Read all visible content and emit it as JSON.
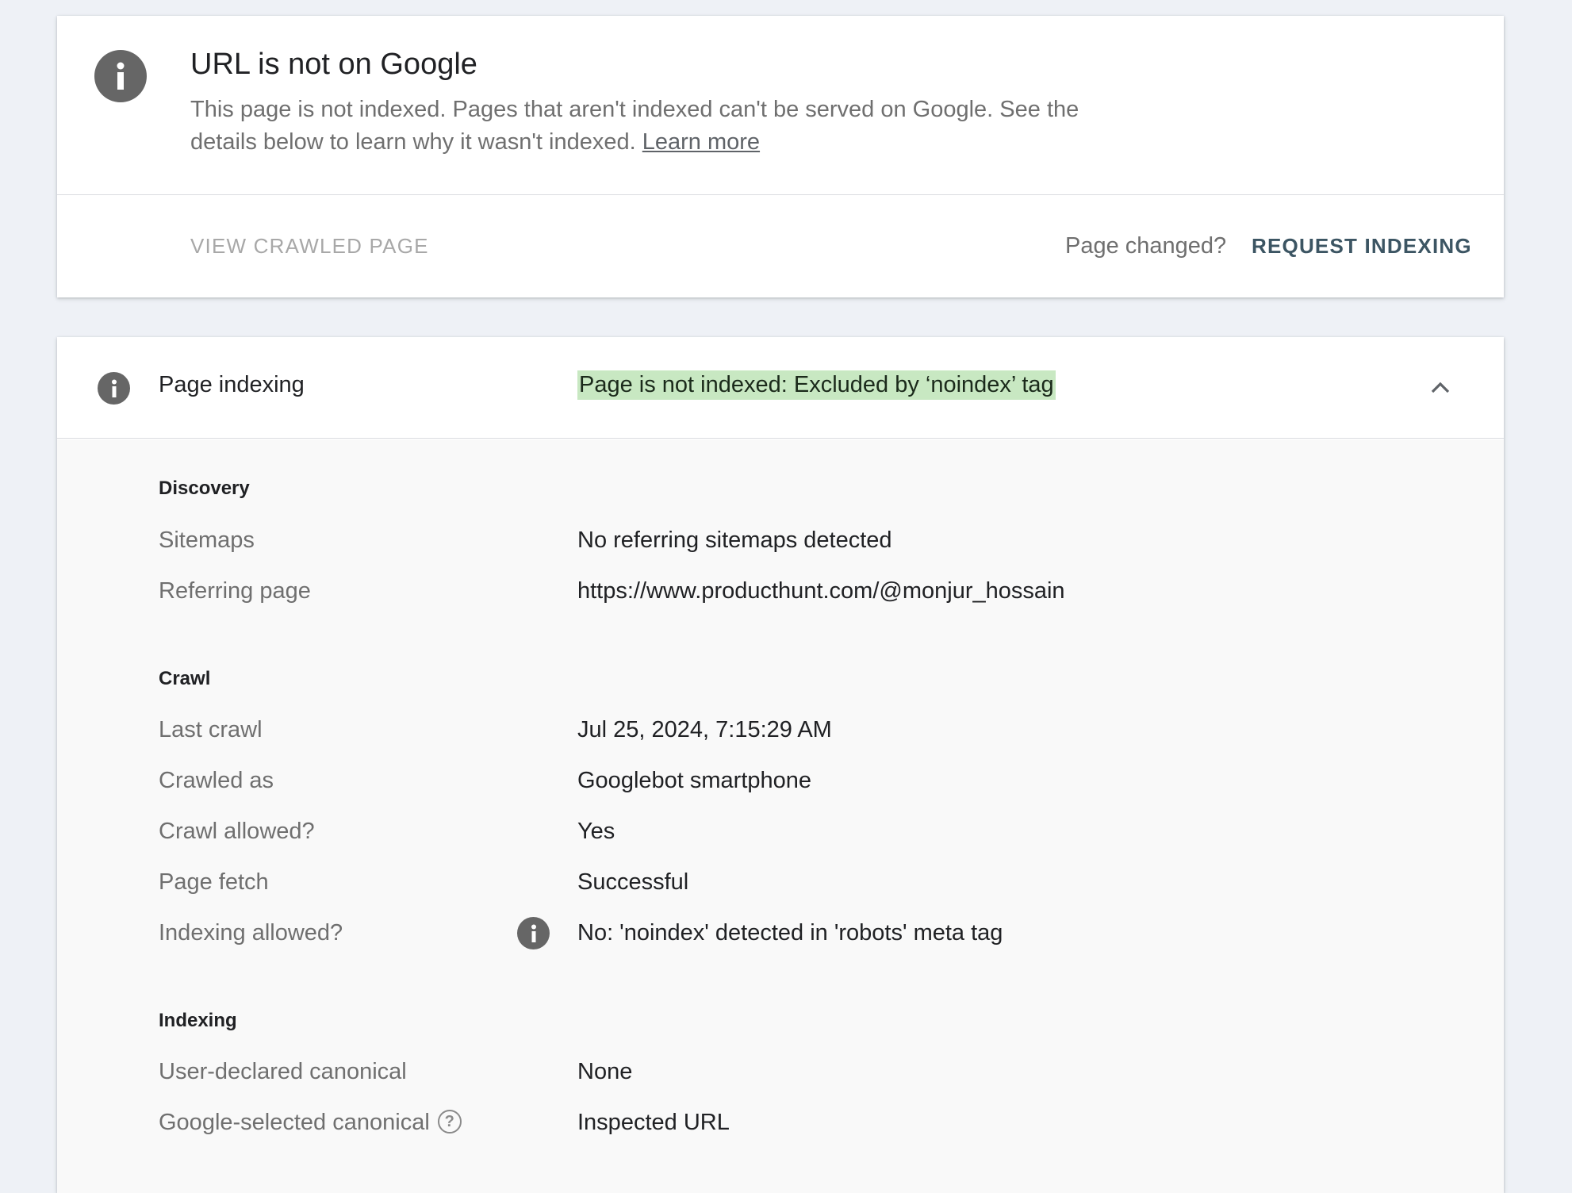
{
  "status_card": {
    "icon": "info-icon",
    "title": "URL is not on Google",
    "description": "This page is not indexed. Pages that aren't indexed can't be served on Google. See the details below to learn why it wasn't indexed.",
    "learn_more": "Learn more",
    "view_crawled_page": "VIEW CRAWLED PAGE",
    "page_changed": "Page changed?",
    "request_indexing": "REQUEST INDEXING"
  },
  "page_indexing": {
    "icon": "info-icon",
    "label": "Page indexing",
    "status": "Page is not indexed: Excluded by ‘noindex’ tag",
    "highlight_color": "#c8e8c2",
    "expanded": true,
    "sections": {
      "discovery": {
        "heading": "Discovery",
        "sitemaps_label": "Sitemaps",
        "sitemaps_value": "No referring sitemaps detected",
        "referring_label": "Referring page",
        "referring_value": "https://www.producthunt.com/@monjur_hossain"
      },
      "crawl": {
        "heading": "Crawl",
        "last_crawl_label": "Last crawl",
        "last_crawl_value": "Jul 25, 2024, 7:15:29 AM",
        "crawled_as_label": "Crawled as",
        "crawled_as_value": "Googlebot smartphone",
        "crawl_allowed_label": "Crawl allowed?",
        "crawl_allowed_value": "Yes",
        "page_fetch_label": "Page fetch",
        "page_fetch_value": "Successful",
        "indexing_allowed_label": "Indexing allowed?",
        "indexing_allowed_value": "No: 'noindex' detected in 'robots' meta tag"
      },
      "indexing": {
        "heading": "Indexing",
        "user_canonical_label": "User-declared canonical",
        "user_canonical_value": "None",
        "google_canonical_label": "Google-selected canonical",
        "google_canonical_help": "?",
        "google_canonical_value": "Inspected URL"
      }
    }
  }
}
